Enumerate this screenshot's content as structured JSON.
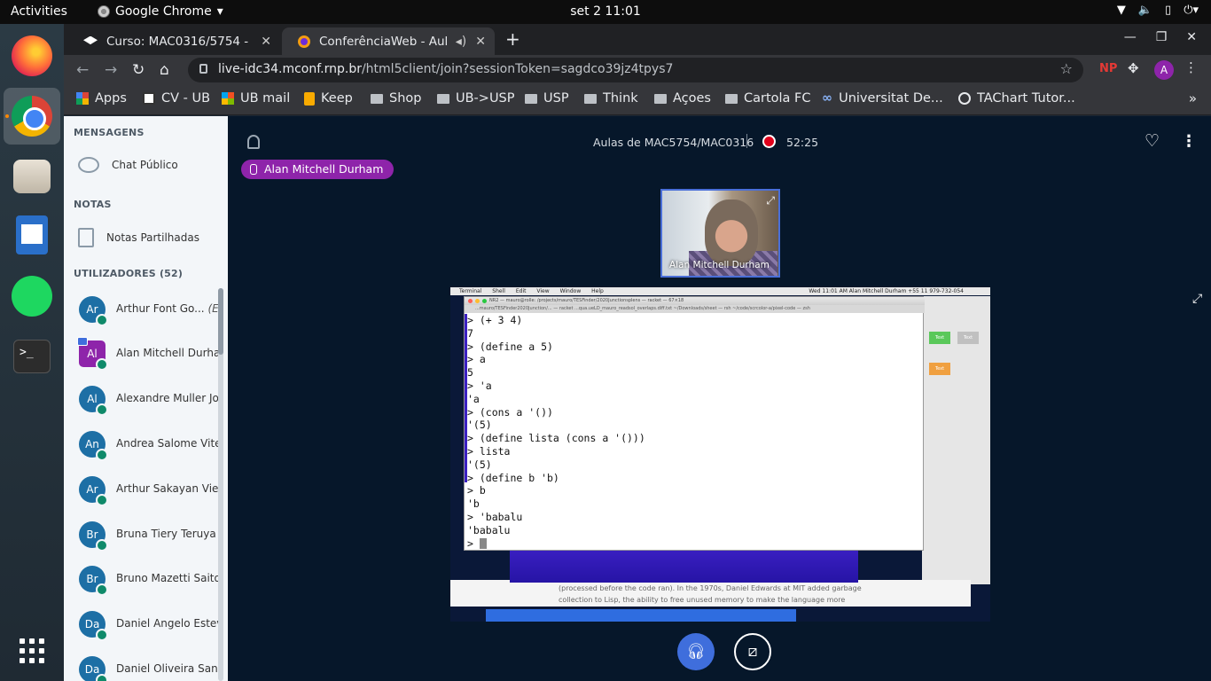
{
  "topbar": {
    "activities": "Activities",
    "app_name": "Google Chrome",
    "clock": "set 2  11:01"
  },
  "browser": {
    "tabs": [
      {
        "title": "Curso: MAC0316/5754 - Co",
        "close": "✕"
      },
      {
        "title": "ConferênciaWeb - Aula",
        "close": "✕"
      }
    ],
    "url_host": "live-idc34.mconf.rnp.br",
    "url_path": "/html5client/join?sessionToken=sagdco39jz4tpys7",
    "avatar": "A",
    "ext_np": "NP",
    "bookmarks": [
      {
        "label": "Apps"
      },
      {
        "label": "CV - UB"
      },
      {
        "label": "UB mail"
      },
      {
        "label": "Keep"
      },
      {
        "label": "Shop"
      },
      {
        "label": "UB->USP"
      },
      {
        "label": "USP"
      },
      {
        "label": "Think"
      },
      {
        "label": "Açoes"
      },
      {
        "label": "Cartola FC"
      },
      {
        "label": "Universitat De..."
      },
      {
        "label": "TAChart Tutor..."
      }
    ]
  },
  "sidebar": {
    "messages_title": "MENSAGENS",
    "public_chat": "Chat Público",
    "notes_title": "NOTAS",
    "shared_notes": "Notas Partilhadas",
    "users_title": "UTILIZADORES (52)",
    "users": [
      {
        "initials": "Ar",
        "name": "Arthur Font Go...",
        "suffix": "(Eu)"
      },
      {
        "initials": "Al",
        "name": "Alan Mitchell Durham",
        "suffix": ""
      },
      {
        "initials": "Al",
        "name": "Alexandre Muller Jo...",
        "suffix": ""
      },
      {
        "initials": "An",
        "name": "Andrea Salome Vite...",
        "suffix": ""
      },
      {
        "initials": "Ar",
        "name": "Arthur Sakayan Viei...",
        "suffix": ""
      },
      {
        "initials": "Br",
        "name": "Bruna Tiery Teruya",
        "suffix": ""
      },
      {
        "initials": "Br",
        "name": "Bruno Mazetti Saito",
        "suffix": ""
      },
      {
        "initials": "Da",
        "name": "Daniel Angelo Estev...",
        "suffix": ""
      },
      {
        "initials": "Da",
        "name": "Daniel Oliveira San...",
        "suffix": ""
      }
    ]
  },
  "meeting": {
    "title": "Aulas de MAC5754/MAC0316",
    "recording_time": "52:25",
    "talking": "Alan Mitchell Durham",
    "webcam_name": "Alan Mitchell Durham"
  },
  "screenshare": {
    "mac_menu": [
      "Terminal",
      "Shell",
      "Edit",
      "View",
      "Window",
      "Help"
    ],
    "mac_status": "Wed 11:01 AM   Alan Mitchell Durham +55 11 979-732-054",
    "term_title": "NR2 — mauro@rolle: /projects/mauro/TESFinder/2020Junctionsplens — racket — 67×18",
    "term_tabs": "...mauro/TESFinder2020Junction/... — racket        ...qua.ueLD_mauro_readsol_overlaps.diff.txt        ~/Downloads/sheet — rsh        ~/code/scrcolor-a/pixel-code — zsh",
    "terminal_lines": [
      "> (+ 3 4)",
      "7",
      "> (define a 5)",
      "> a",
      "5",
      "> 'a",
      "'a",
      "> (cons a '())",
      "'(5)",
      "> (define lista (cons a '()))",
      "> lista",
      "'(5)",
      "> (define b 'b)",
      "> b",
      "'b",
      "> 'babalu",
      "'babalu",
      "> "
    ],
    "doc_text_1": "(processed before the code ran). In the 1970s, Daniel Edwards at MIT added garbage",
    "doc_text_2": "collection to Lisp, the ability to free unused memory to make the language more",
    "right_buttons": [
      "Text",
      "Text",
      "Text"
    ]
  },
  "colors": {
    "accent_purple": "#8e24aa",
    "audio_blue": "#3f6edc",
    "recording_red": "#e0001b",
    "avatar_blue": "#1d6fa5"
  }
}
